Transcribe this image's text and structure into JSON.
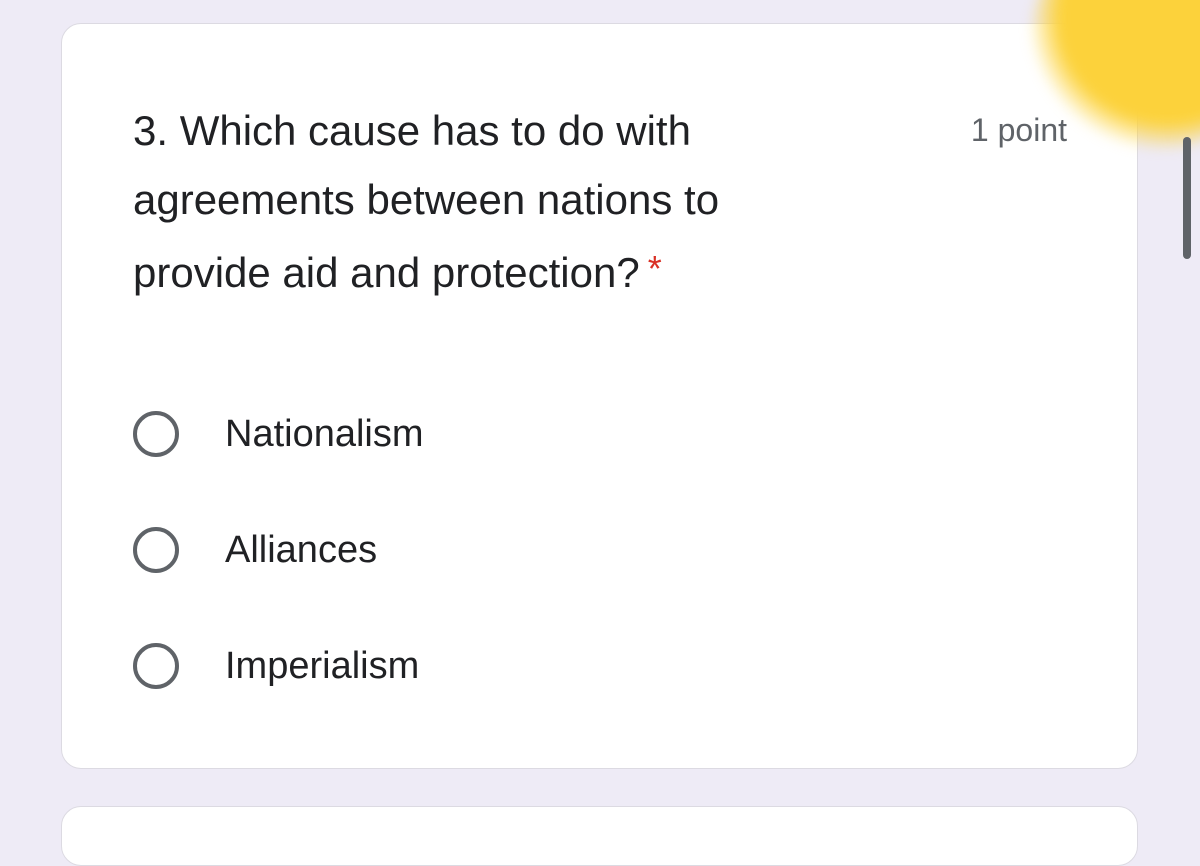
{
  "question": {
    "text": "3. Which cause has to do with agreements between nations to provide aid and protection?",
    "required_marker": "*",
    "points": "1 point"
  },
  "options": [
    {
      "label": "Nationalism",
      "selected": false
    },
    {
      "label": "Alliances",
      "selected": false
    },
    {
      "label": "Imperialism",
      "selected": false
    }
  ],
  "colors": {
    "page_background": "#eeebf6",
    "card_background": "#ffffff",
    "required_marker": "#d93025",
    "text_primary": "#202124",
    "text_secondary": "#5f6368",
    "highlight": "#fcd23b"
  }
}
